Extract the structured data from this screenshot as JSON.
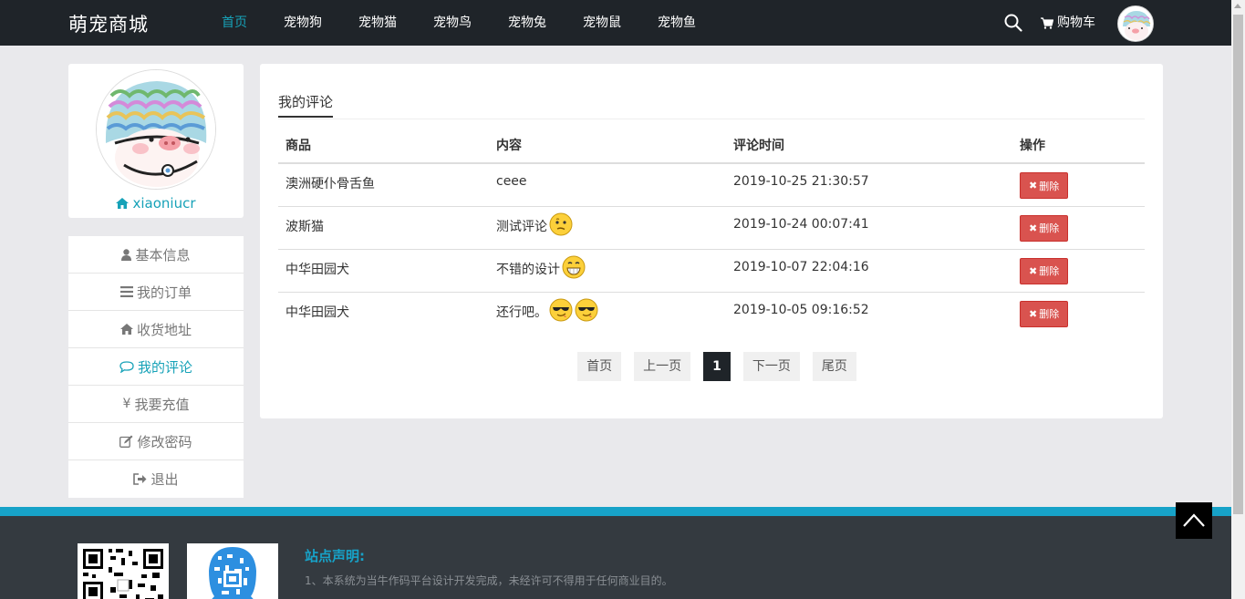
{
  "navbar": {
    "brand": "萌宠商城",
    "links": [
      "首页",
      "宠物狗",
      "宠物猫",
      "宠物鸟",
      "宠物兔",
      "宠物鼠",
      "宠物鱼"
    ],
    "active_index": 0,
    "cart_label": "购物车",
    "accent_color": "#17a2b8"
  },
  "profile": {
    "username": "xiaoniucr"
  },
  "side_menu": {
    "items": [
      {
        "label": "基本信息",
        "icon": "user-icon"
      },
      {
        "label": "我的订单",
        "icon": "list-icon"
      },
      {
        "label": "收货地址",
        "icon": "home-icon"
      },
      {
        "label": "我的评论",
        "icon": "comment-icon"
      },
      {
        "label": "我要充值",
        "icon": "yen-icon"
      },
      {
        "label": "修改密码",
        "icon": "edit-icon"
      },
      {
        "label": "退出",
        "icon": "sign-out-icon"
      }
    ],
    "active_index": 3
  },
  "comments": {
    "tab_label": "我的评论",
    "columns": [
      "商品",
      "内容",
      "评论时间",
      "操作"
    ],
    "rows": [
      {
        "product": "澳洲硬仆骨舌鱼",
        "content": "ceee",
        "emojis": [],
        "time": "2019-10-25 21:30:57"
      },
      {
        "product": "波斯猫",
        "content": "测试评论",
        "emojis": [
          "thinking-emoji"
        ],
        "time": "2019-10-24 00:07:41"
      },
      {
        "product": "中华田园犬",
        "content": "不错的设计",
        "emojis": [
          "grin-emoji"
        ],
        "time": "2019-10-07 22:04:16"
      },
      {
        "product": "中华田园犬",
        "content": "还行吧。",
        "emojis": [
          "cool-emoji",
          "cool-emoji"
        ],
        "time": "2019-10-05 09:16:52"
      }
    ],
    "delete_label": "删除",
    "delete_color": "#d9534f"
  },
  "pager": {
    "first": "首页",
    "prev": "上一页",
    "current": "1",
    "next": "下一页",
    "last": "尾页"
  },
  "footer": {
    "title": "站点声明:",
    "line1": "1、本系统为当牛作码平台设计开发完成，未经许可不得用于任何商业目的。"
  }
}
